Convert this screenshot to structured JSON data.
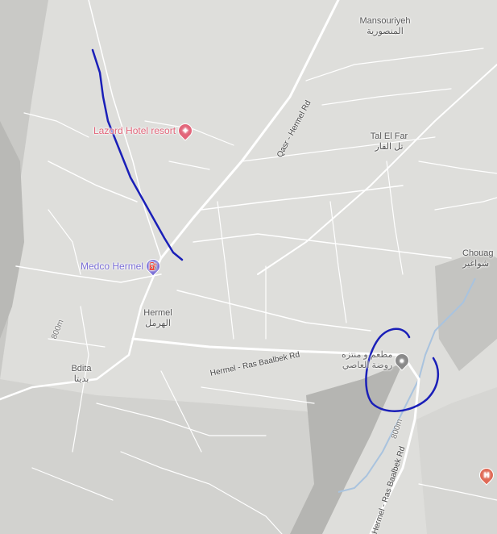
{
  "places": {
    "mansouriyeh": {
      "en": "Mansouriyeh",
      "ar": "المنصورية"
    },
    "tal_el_far": {
      "en": "Tal El Far",
      "ar": "تل الفار"
    },
    "hermel": {
      "en": "Hermel",
      "ar": "الهرمل"
    },
    "bdita": {
      "en": "Bdita",
      "ar": "بديتا"
    },
    "chouag": {
      "en": "Chouag",
      "ar": "شواغير"
    }
  },
  "pois": {
    "hotel": {
      "label": "Lazord Hotel resort",
      "color": "#e2657a",
      "icon": "hotel-icon"
    },
    "fuel": {
      "label": "Medco Hermel",
      "color": "#7b6fd6",
      "icon": "fuel-icon"
    },
    "restaurant": {
      "label_line1": "مطعم و منتزه",
      "label_line2": "روضة العاصي",
      "icon": "pin-icon",
      "color": "#8a8a8a"
    },
    "hospital": {
      "icon": "hospital-icon",
      "color": "#e06a56",
      "glyph": "H"
    }
  },
  "roads": {
    "qasr_hermel": "Qasr - Hermel Rd",
    "hermel_ras_baalbek": "Hermel - Ras Baalbek Rd",
    "ras_baalbek": "Hermel - Ras Baalbek Rd"
  },
  "elevation": {
    "left": "800m",
    "right": "800m"
  },
  "annotations": {
    "stroke_color": "#1a1fb8"
  }
}
